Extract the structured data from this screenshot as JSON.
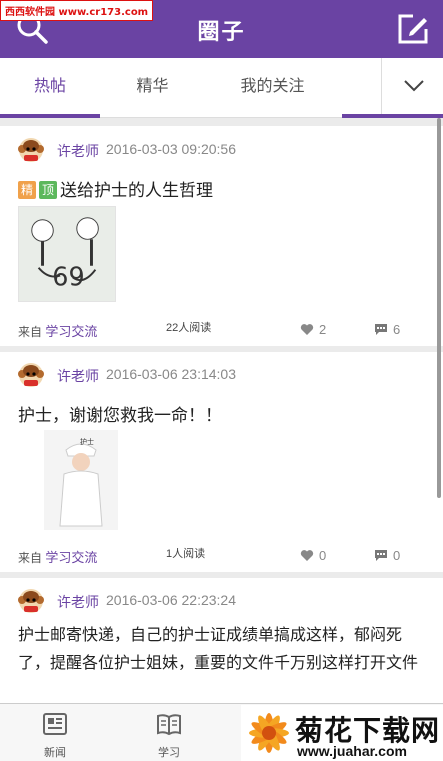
{
  "watermark": "西西软件园 www.cr173.com",
  "header": {
    "title": "圈子"
  },
  "tabs": [
    {
      "label": "热帖",
      "active": true
    },
    {
      "label": "精华",
      "active": false
    },
    {
      "label": "我的关注",
      "active": false
    }
  ],
  "posts": [
    {
      "author": "许老师",
      "time": "2016-03-03 09:20:56",
      "badges": [
        "精",
        "顶"
      ],
      "title": "送给护士的人生哲理",
      "source_prefix": "来自",
      "source": "学习交流",
      "reads": "22人阅读",
      "likes": "2",
      "comments": "6"
    },
    {
      "author": "许老师",
      "time": "2016-03-06 23:14:03",
      "title": "护士，谢谢您救我一命！！",
      "source_prefix": "来自",
      "source": "学习交流",
      "reads": "1人阅读",
      "likes": "0",
      "comments": "0"
    },
    {
      "author": "许老师",
      "time": "2016-03-06 22:23:24",
      "body": "护士邮寄快递，自己的护士证成绩单搞成这样，郁闷死了，提醒各位护士姐妹，重要的文件千万别这样打开文件"
    }
  ],
  "bottom_nav": [
    {
      "label": "新闻",
      "icon": "news-icon"
    },
    {
      "label": "学习",
      "icon": "book-icon"
    }
  ],
  "brand": {
    "name": "菊花下载网",
    "url": "www.juahar.com"
  },
  "colors": {
    "accent": "#6a43a3",
    "header_bg": "#6a43a3",
    "badge_jing": "#f0a14a",
    "badge_ding": "#5cb85c"
  }
}
